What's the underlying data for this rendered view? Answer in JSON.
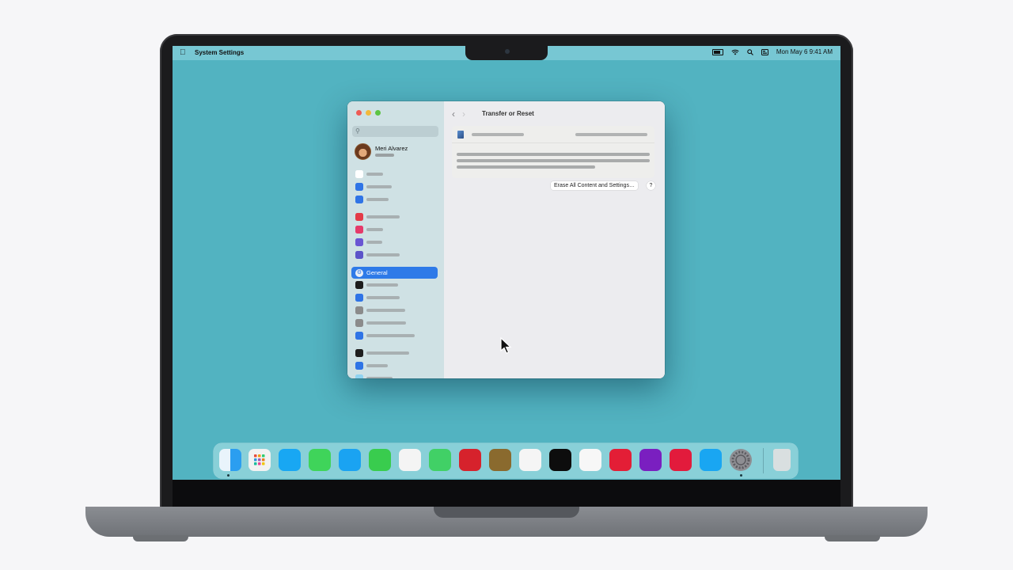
{
  "menubar": {
    "app_name": "System Settings",
    "date_time": "Mon May 6  9:41 AM",
    "icons": [
      "apple-icon",
      "battery-icon",
      "wifi-icon",
      "search-icon",
      "control-center-icon"
    ]
  },
  "window": {
    "title": "Transfer or Reset",
    "search_placeholder": "",
    "user_name": "Meri Alvarez",
    "selected_item": "General",
    "erase_button": "Erase All Content and Settings…",
    "help_button": "?",
    "sidebar_icon_colors": [
      "#ffffff",
      "#2f74e6",
      "#2f74e6",
      "#e33b48",
      "#e53a6a",
      "#6a55d3",
      "#5c54c9",
      "#2e7ae8",
      "#1c1c1c",
      "#2f74e6",
      "#8b8b8b",
      "#8b8b8b",
      "#2f74e6",
      "#1e1e1e",
      "#2f74e6",
      "#8fd3f0"
    ]
  },
  "dock": {
    "icons": [
      "finder-icon",
      "launchpad-icon",
      "safari-icon",
      "messages-icon",
      "mail-icon",
      "facetime-icon",
      "photos-icon",
      "maps-icon",
      "calendar-icon",
      "notes-icon",
      "reminders-icon",
      "tv-icon",
      "freeform-icon",
      "music-icon",
      "podcasts-icon",
      "news-icon",
      "app-store-icon",
      "system-settings-icon",
      "trash-icon"
    ],
    "colors": [
      "#2b9ef0",
      "#f2f2f2",
      "#18a7f3",
      "#3fd45a",
      "#1aa3f2",
      "#39cc4e",
      "#f4f4f4",
      "#41d066",
      "#d6222c",
      "#8a6a2e",
      "#f5f5f5",
      "#0d0d0d",
      "#f7f7f7",
      "#e31e36",
      "#7a1fc0",
      "#e21b3c",
      "#19a6f2",
      "#8e8e93",
      "#d9dfe0"
    ]
  }
}
